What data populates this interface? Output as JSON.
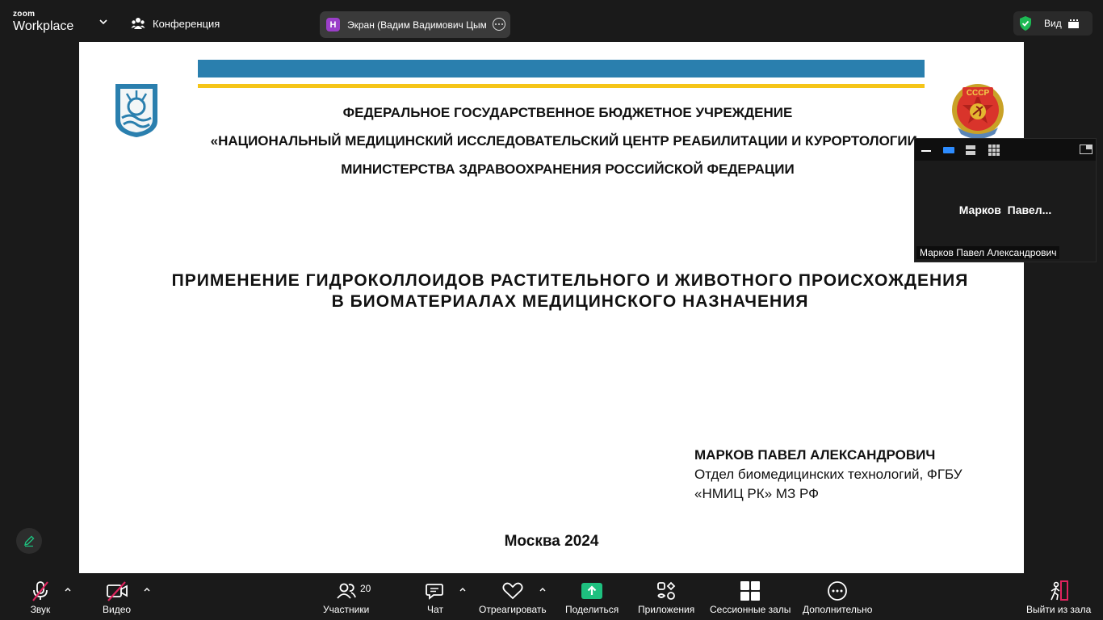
{
  "topbar": {
    "logo_top": "zoom",
    "logo_bottom": "Workplace",
    "meeting_label": "Конференция",
    "share_avatar_letter": "Н",
    "share_label": "Экран (Вадим Вадимович Цымба",
    "view_label": "Вид",
    "shield_color": "#1db954"
  },
  "slide": {
    "header_line1": "ФЕДЕРАЛЬНОЕ ГОСУДАРСТВЕННОЕ БЮДЖЕТНОЕ УЧРЕЖДЕНИЕ",
    "header_line2": "«НАЦИОНАЛЬНЫЙ МЕДИЦИНСКИЙ ИССЛЕДОВАТЕЛЬСКИЙ ЦЕНТР РЕАБИЛИТАЦИИ И КУРОРТОЛОГИИ»",
    "header_line3": "МИНИСТЕРСТВА ЗДРАВООХРАНЕНИЯ РОССИЙСКОЙ ФЕДЕРАЦИИ",
    "title_line1": "ПРИМЕНЕНИЕ ГИДРОКОЛЛОИДОВ РАСТИТЕЛЬНОГО И ЖИВОТНОГО ПРОИСХОЖДЕНИЯ",
    "title_line2": "В БИОМАТЕРИАЛАХ МЕДИЦИНСКОГО НАЗНАЧЕНИЯ",
    "author_name": "МАРКОВ ПАВЕЛ АЛЕКСАНДРОВИЧ",
    "author_line2": "Отдел биомедицинских технологий, ФГБУ",
    "author_line3": "«НМИЦ РК» МЗ РФ",
    "city_year": "Москва 2024",
    "order_text": "СССР",
    "accent_blue": "#2a7fae",
    "accent_yellow": "#f5c518"
  },
  "video_window": {
    "display_name": "Марков  Павел...",
    "full_name": "Марков Павел Александрович"
  },
  "toolbar": {
    "audio": "Звук",
    "video": "Видео",
    "participants": "Участники",
    "participants_count": "20",
    "chat": "Чат",
    "react": "Отреагировать",
    "share": "Поделиться",
    "apps": "Приложения",
    "breakout": "Сессионные залы",
    "more": "Дополнительно",
    "leave": "Выйти из зала",
    "share_color": "#1ec07f",
    "mute_color": "#e0245e"
  }
}
